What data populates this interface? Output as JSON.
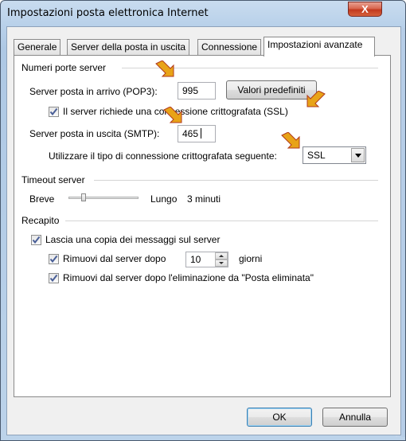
{
  "window": {
    "title": "Impostazioni posta elettronica Internet",
    "close_glyph": "X"
  },
  "tabs": [
    {
      "label": "Generale",
      "active": false
    },
    {
      "label": "Server della posta in uscita",
      "active": false
    },
    {
      "label": "Connessione",
      "active": false
    },
    {
      "label": "Impostazioni avanzate",
      "active": true
    }
  ],
  "ports": {
    "group_label": "Numeri porte server",
    "incoming_label": "Server posta in arrivo (POP3):",
    "incoming_value": "995",
    "defaults_button": "Valori predefiniti",
    "ssl_checkbox_label": "Il server richiede una connessione crittografata (SSL)",
    "ssl_checked": true,
    "outgoing_label": "Server posta in uscita (SMTP):",
    "outgoing_value": "465",
    "encryption_label": "Utilizzare il tipo di connessione crittografata seguente:",
    "encryption_value": "SSL"
  },
  "timeout": {
    "group_label": "Timeout server",
    "short_label": "Breve",
    "long_label": "Lungo",
    "value_text": "3 minuti",
    "slider_level": 0.2
  },
  "delivery": {
    "group_label": "Recapito",
    "leave_copy_label": "Lascia una copia dei messaggi sul server",
    "leave_copy_checked": true,
    "remove_after_label": "Rimuovi dal server dopo",
    "remove_after_checked": true,
    "remove_after_days": "10",
    "days_label": "giorni",
    "remove_deleted_label": "Rimuovi dal server dopo l'eliminazione da \"Posta eliminata\"",
    "remove_deleted_checked": true
  },
  "footer": {
    "ok_label": "OK",
    "cancel_label": "Annulla"
  },
  "colors": {
    "annotation_marker": "#e8a317",
    "annotation_marker_dark": "#c0392b"
  }
}
